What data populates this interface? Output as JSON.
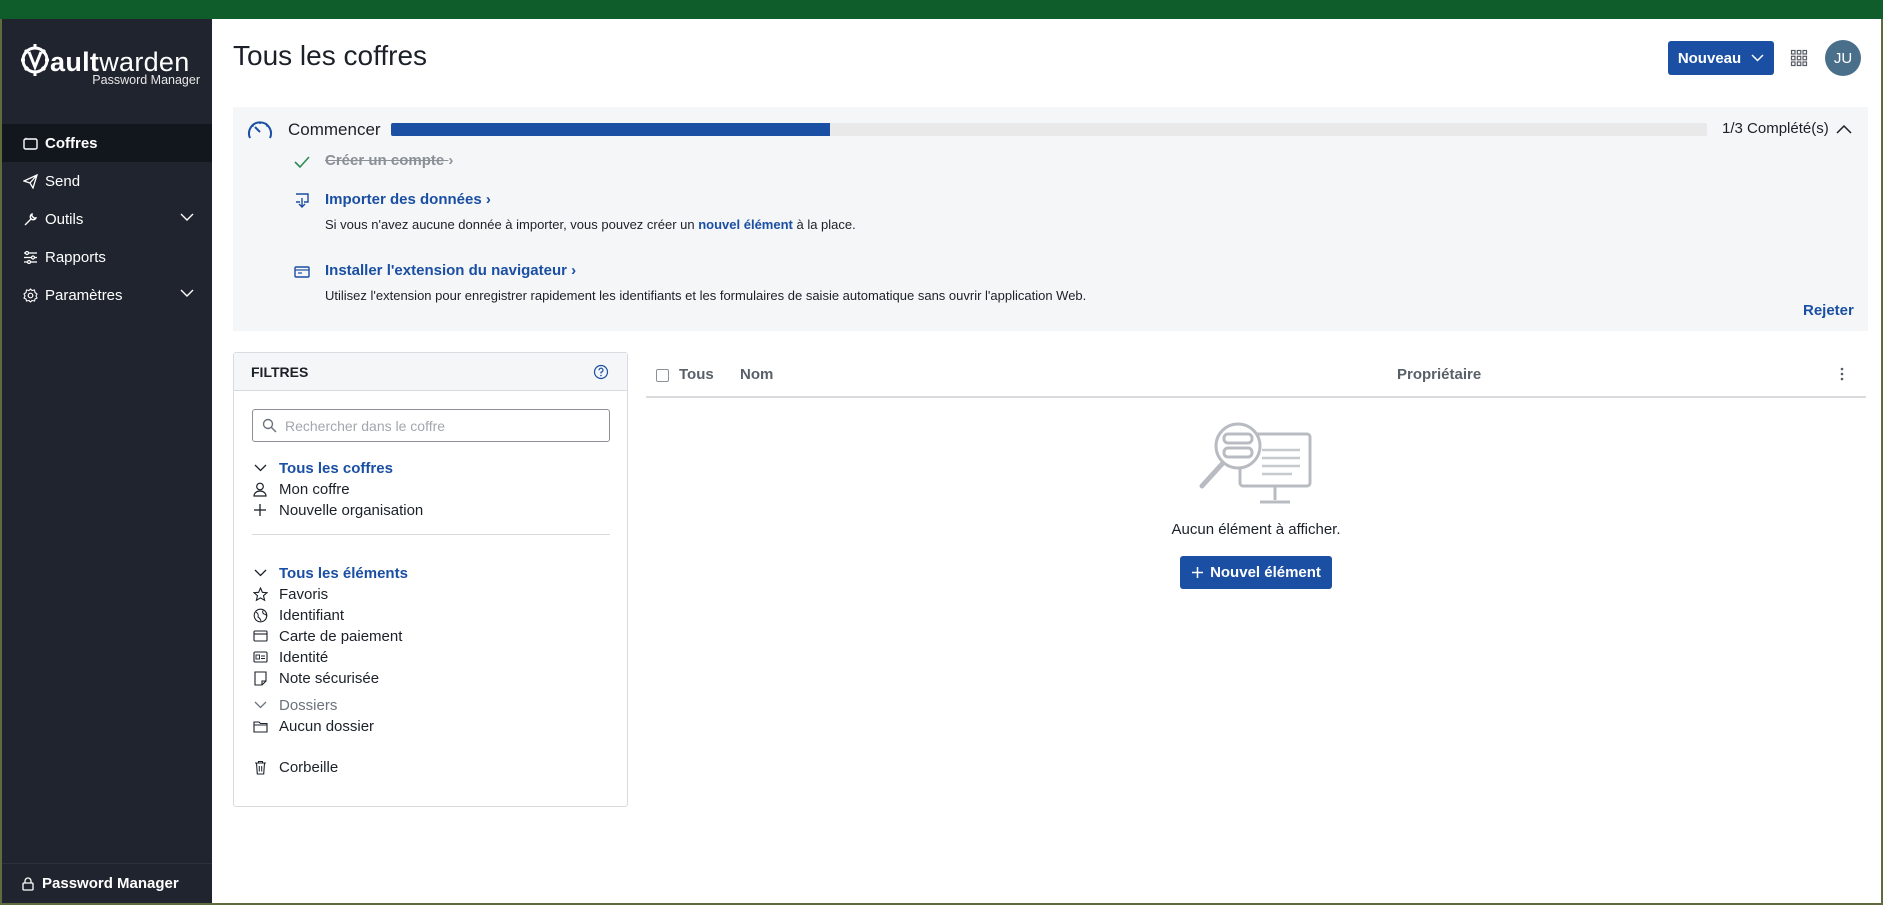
{
  "app": {
    "brand_prefix": "V",
    "brand_name_bold": "ault",
    "brand_name_rest": "warden",
    "brand_subtitle": "Password Manager"
  },
  "sidebar": {
    "items": [
      {
        "label": "Coffres",
        "icon": "vault-icon",
        "active": true
      },
      {
        "label": "Send",
        "icon": "send-icon"
      },
      {
        "label": "Outils",
        "icon": "wrench-icon",
        "expandable": true
      },
      {
        "label": "Rapports",
        "icon": "sliders-icon"
      },
      {
        "label": "Paramètres",
        "icon": "gear-icon",
        "expandable": true
      }
    ],
    "footer_label": "Password Manager"
  },
  "header": {
    "title": "Tous les coffres",
    "new_button": "Nouveau",
    "avatar_initials": "JU"
  },
  "onboarding": {
    "title": "Commencer",
    "progress_fraction": 0.3333,
    "progress_label": "1/3 Complété(s)",
    "tasks": [
      {
        "label": "Créer un compte",
        "done": true
      },
      {
        "label": "Importer des données",
        "desc_before": "Si vous n'avez aucune donnée à importer, vous pouvez créer un ",
        "desc_link": "nouvel élément",
        "desc_after": " à la place."
      },
      {
        "label": "Installer l'extension du navigateur",
        "desc": "Utilisez l'extension pour enregistrer rapidement les identifiants et les formulaires de saisie automatique sans ouvrir l'application Web."
      }
    ],
    "dismiss": "Rejeter"
  },
  "filters": {
    "title": "FILTRES",
    "search_placeholder": "Rechercher dans le coffre",
    "vaults_section": "Tous les coffres",
    "vaults": [
      "Mon coffre",
      "Nouvelle organisation"
    ],
    "items_section": "Tous les éléments",
    "types": [
      "Favoris",
      "Identifiant",
      "Carte de paiement",
      "Identité",
      "Note sécurisée"
    ],
    "folders_section": "Dossiers",
    "folders": [
      "Aucun dossier"
    ],
    "trash": "Corbeille"
  },
  "table": {
    "col_all": "Tous",
    "col_name": "Nom",
    "col_owner": "Propriétaire",
    "empty_text": "Aucun élément à afficher.",
    "add_button": "Nouvel élément"
  },
  "colors": {
    "accent": "#1a4fa3",
    "sidebar_bg": "#1f242e",
    "topbar": "#0f5d2a"
  }
}
